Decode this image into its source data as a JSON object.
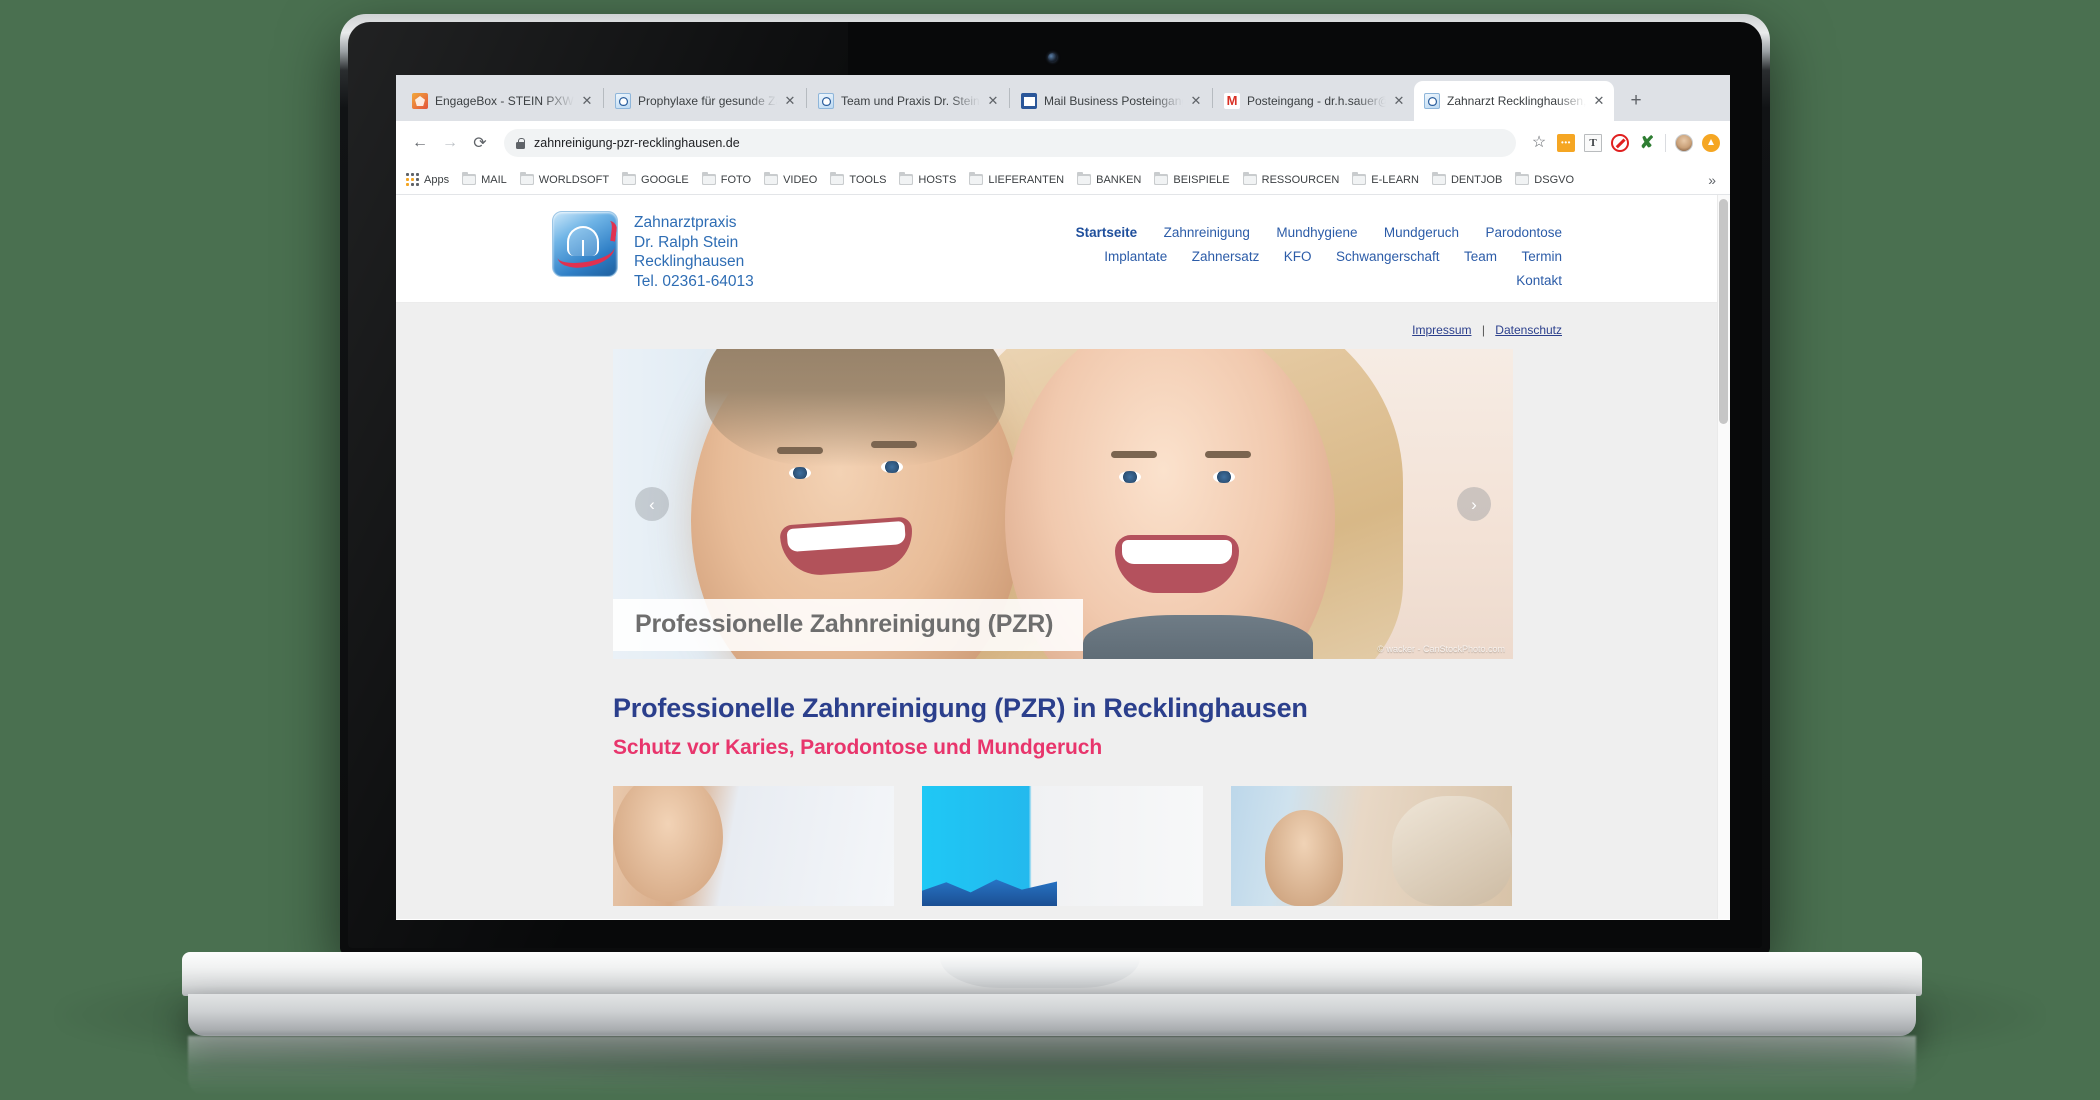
{
  "browser": {
    "tabs": [
      {
        "title": "EngageBox - STEIN PXWS -",
        "favicon": "engagebox-icon",
        "active": false
      },
      {
        "title": "Prophylaxe für gesunde Zäh",
        "favicon": "tooth-icon",
        "active": false
      },
      {
        "title": "Team und Praxis Dr. Stein -",
        "favicon": "tooth-icon",
        "active": false
      },
      {
        "title": "Mail Business Posteingang",
        "favicon": "outlook-icon",
        "active": false
      },
      {
        "title": "Posteingang - dr.h.sauer@g",
        "favicon": "gmail-icon",
        "active": false
      },
      {
        "title": "Zahnarzt Recklinghausen, D",
        "favicon": "tooth-icon",
        "active": true
      }
    ],
    "new_tab_label": "+",
    "close_label": "✕",
    "nav": {
      "back": "←",
      "forward": "→",
      "reload": "⟳"
    },
    "omnibox": {
      "url": "zahnreinigung-pzr-recklinghausen.de",
      "lock_icon": "lock-icon"
    },
    "toolbar_icons": [
      "bookmark-star-icon",
      "extension-orange-icon",
      "text-tool-icon",
      "adblock-icon",
      "close-x-icon",
      "profile-avatar-icon",
      "upload-icon"
    ],
    "bookmarks": {
      "apps_label": "Apps",
      "folders": [
        "MAIL",
        "WORLDSOFT",
        "GOOGLE",
        "FOTO",
        "VIDEO",
        "TOOLS",
        "HOSTS",
        "LIEFERANTEN",
        "BANKEN",
        "BEISPIELE",
        "RESSOURCEN",
        "E-LEARN",
        "DENTJOB",
        "DSGVO"
      ],
      "overflow_label": "»"
    }
  },
  "site": {
    "logo": {
      "line1": "Zahnarztpraxis",
      "line2": "Dr. Ralph Stein",
      "line3": "Recklinghausen",
      "line4": "Tel. 02361-64013"
    },
    "nav_row1": [
      "Startseite",
      "Zahnreinigung",
      "Mundhygiene",
      "Mundgeruch",
      "Parodontose"
    ],
    "nav_row2": [
      "Implantate",
      "Zahnersatz",
      "KFO",
      "Schwangerschaft",
      "Team",
      "Termin",
      "Kontakt"
    ],
    "active_nav": "Startseite",
    "legal": {
      "impressum": "Impressum",
      "separator": "|",
      "datenschutz": "Datenschutz"
    },
    "hero": {
      "caption": "Professionelle Zahnreinigung (PZR)",
      "credit": "© wacker - CanStockPhoto.com",
      "prev_label": "‹",
      "next_label": "›"
    },
    "h1": "Professionelle Zahnreinigung (PZR) in Recklinghausen",
    "h2": "Schutz vor Karies, Parodontose und Mundgeruch"
  },
  "colors": {
    "background": "#4a7050",
    "heading_blue": "#2b3f8c",
    "heading_pink": "#e8356c",
    "nav_blue": "#2c5ca8",
    "logo_blue": "#2e6db4",
    "logo_red": "#e03150",
    "page_bg": "#efefef"
  }
}
